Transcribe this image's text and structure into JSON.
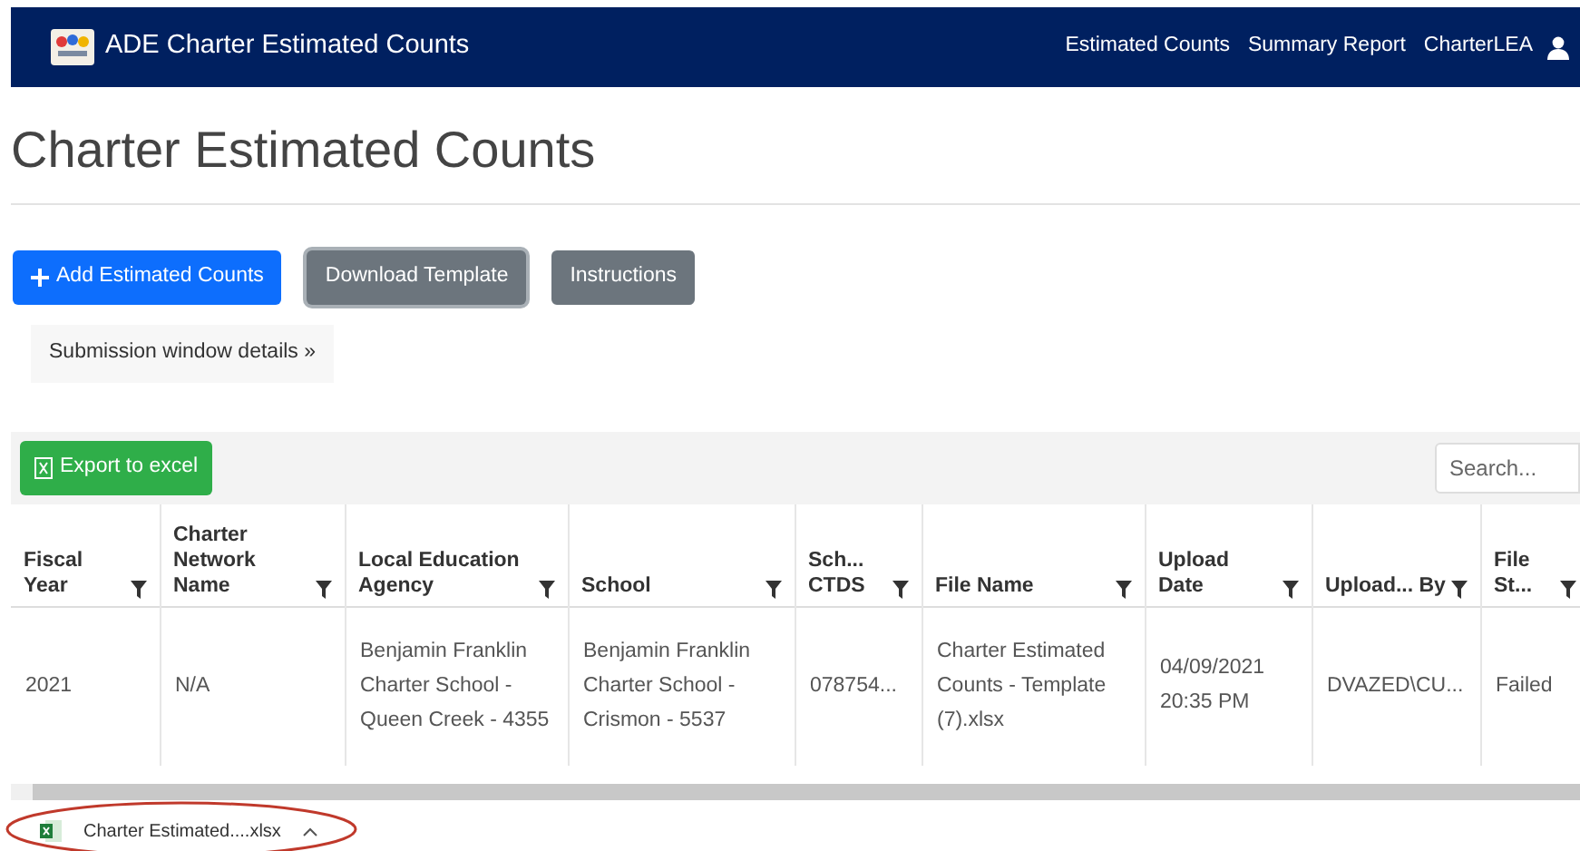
{
  "navbar": {
    "brand": "ADE Charter Estimated Counts",
    "links": [
      "Estimated Counts",
      "Summary Report",
      "CharterLEA"
    ]
  },
  "page_title": "Charter Estimated Counts",
  "buttons": [
    {
      "label": "Add Estimated Counts",
      "kind": "primary"
    },
    {
      "label": "Download Template",
      "kind": "focused"
    },
    {
      "label": "Instructions",
      "kind": "secondary"
    }
  ],
  "submission_window": "Submission window details »",
  "grid": {
    "export_button": "Export to excel",
    "search": {
      "placeholder": "Search..."
    },
    "columns": [
      "Fiscal Year",
      "Charter Network Name",
      "Local Education Agency",
      "School",
      "Sch... CTDS",
      "File Name",
      "Upload Date",
      "Upload... By",
      "File St..."
    ],
    "rows": [
      [
        "2021",
        "N/A",
        "Benjamin Franklin Charter School - Queen Creek - 4355",
        "Benjamin Franklin Charter School - Crismon - 5537",
        "078754...",
        "Charter Estimated Counts - Template (7).xlsx",
        "04/09/2021 20:35 PM",
        "DVAZED\\CU...",
        "Failed"
      ]
    ]
  },
  "download_bar": {
    "file": "Charter Estimated....xlsx"
  }
}
